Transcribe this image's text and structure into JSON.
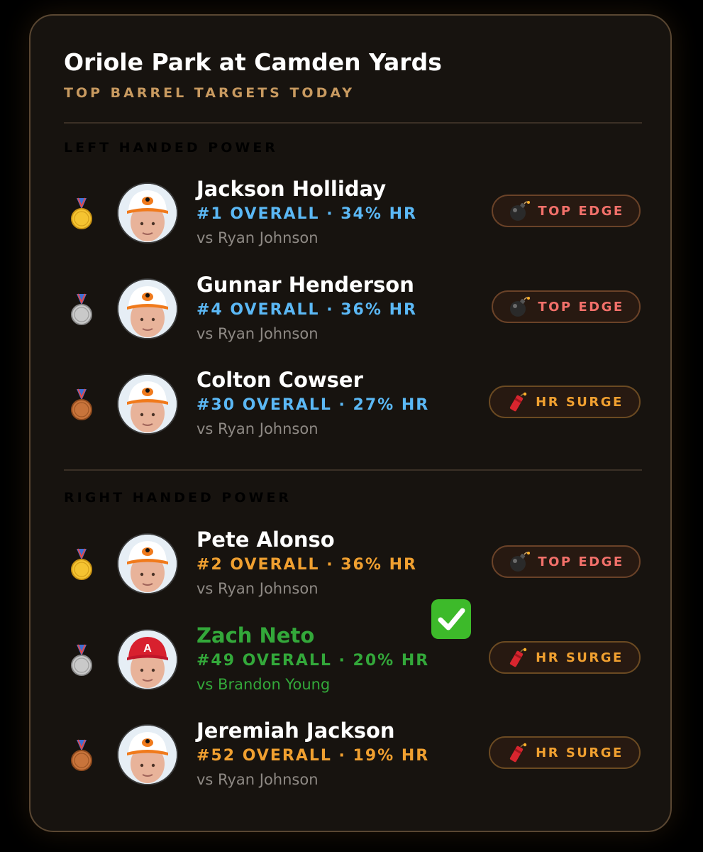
{
  "header": {
    "title": "Oriole Park at Camden Yards",
    "subtitle": "TOP BARREL TARGETS TODAY"
  },
  "colors": {
    "left_accent": "#5bb8f5",
    "right_accent": "#f0a030",
    "top_edge_text": "#f2706a",
    "hr_surge_text": "#f0a030",
    "hit_green": "#33a83a"
  },
  "sections": [
    {
      "label": "LEFT HANDED POWER",
      "players": [
        {
          "medal": "1",
          "name": "Jackson Holliday",
          "rank_text": "#1 OVERALL · 34% HR",
          "opponent": "vs Ryan Johnson",
          "badge": {
            "icon": "bomb-icon",
            "label": "TOP EDGE"
          },
          "cap": "orioles"
        },
        {
          "medal": "2",
          "name": "Gunnar Henderson",
          "rank_text": "#4 OVERALL · 36% HR",
          "opponent": "vs Ryan Johnson",
          "badge": {
            "icon": "bomb-icon",
            "label": "TOP EDGE"
          },
          "cap": "orioles"
        },
        {
          "medal": "3",
          "name": "Colton Cowser",
          "rank_text": "#30 OVERALL · 27% HR",
          "opponent": "vs Ryan Johnson",
          "badge": {
            "icon": "firecracker-icon",
            "label": "HR SURGE"
          },
          "cap": "orioles"
        }
      ]
    },
    {
      "label": "RIGHT HANDED POWER",
      "players": [
        {
          "medal": "1",
          "name": "Pete Alonso",
          "rank_text": "#2 OVERALL · 36% HR",
          "opponent": "vs Ryan Johnson",
          "badge": {
            "icon": "bomb-icon",
            "label": "TOP EDGE"
          },
          "cap": "orioles"
        },
        {
          "medal": "2",
          "name": "Zach Neto",
          "rank_text": "#49 OVERALL · 20% HR",
          "opponent": "vs Brandon Young",
          "badge": {
            "icon": "firecracker-icon",
            "label": "HR SURGE"
          },
          "cap": "angels",
          "hit": true
        },
        {
          "medal": "3",
          "name": "Jeremiah Jackson",
          "rank_text": "#52 OVERALL · 19% HR",
          "opponent": "vs Ryan Johnson",
          "badge": {
            "icon": "firecracker-icon",
            "label": "HR SURGE"
          },
          "cap": "orioles"
        }
      ]
    }
  ]
}
